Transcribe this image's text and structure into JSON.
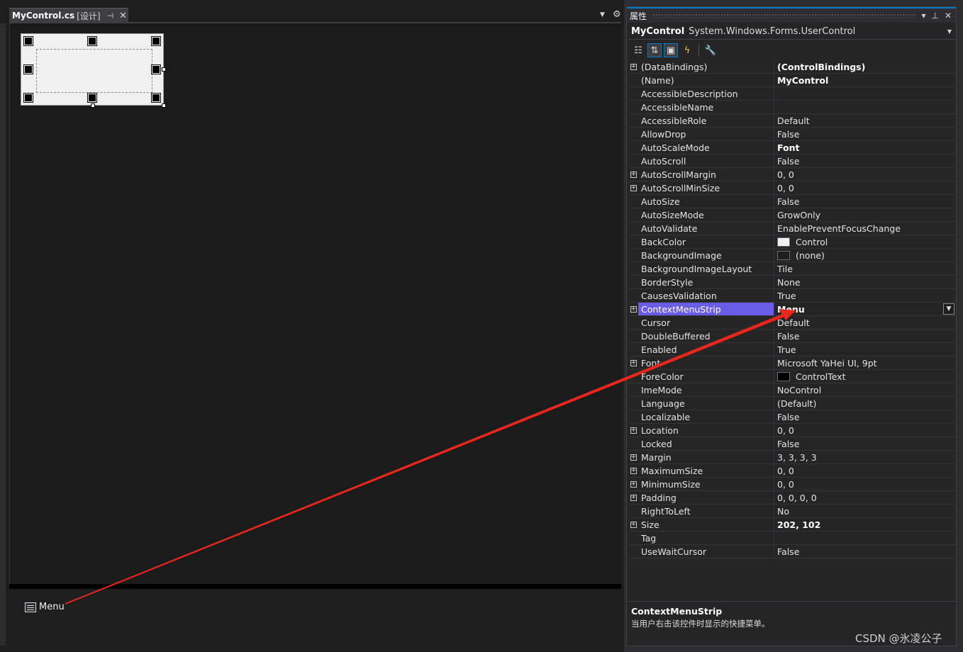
{
  "designer": {
    "tab_name": "MyControl.cs",
    "tab_mode": "[设计]",
    "tab_pin": "⊣",
    "tab_close": "✕",
    "overflow": "▼",
    "settings": "⚙",
    "tray_item_label": "Menu"
  },
  "properties": {
    "title": "属性",
    "title_buttons": [
      "▾",
      "⊥",
      "✕"
    ],
    "object_name": "MyControl",
    "object_type": "System.Windows.Forms.UserControl",
    "toolbar_icons": [
      "categorized-icon",
      "alphabetical-icon",
      "properties-icon",
      "events-icon",
      "property-pages-icon"
    ],
    "rows": [
      {
        "name": "(DataBindings)",
        "value": "(ControlBindings)",
        "expand": true,
        "bold": true
      },
      {
        "name": "(Name)",
        "value": "MyControl",
        "bold": true
      },
      {
        "name": "AccessibleDescription",
        "value": ""
      },
      {
        "name": "AccessibleName",
        "value": ""
      },
      {
        "name": "AccessibleRole",
        "value": "Default"
      },
      {
        "name": "AllowDrop",
        "value": "False"
      },
      {
        "name": "AutoScaleMode",
        "value": "Font",
        "bold": true
      },
      {
        "name": "AutoScroll",
        "value": "False"
      },
      {
        "name": "AutoScrollMargin",
        "value": "0, 0",
        "expand": true
      },
      {
        "name": "AutoScrollMinSize",
        "value": "0, 0",
        "expand": true
      },
      {
        "name": "AutoSize",
        "value": "False"
      },
      {
        "name": "AutoSizeMode",
        "value": "GrowOnly"
      },
      {
        "name": "AutoValidate",
        "value": "EnablePreventFocusChange"
      },
      {
        "name": "BackColor",
        "value": "Control",
        "swatch": "#f0f0f0"
      },
      {
        "name": "BackgroundImage",
        "value": "(none)",
        "swatch": "#1e1e1e"
      },
      {
        "name": "BackgroundImageLayout",
        "value": "Tile"
      },
      {
        "name": "BorderStyle",
        "value": "None"
      },
      {
        "name": "CausesValidation",
        "value": "True"
      },
      {
        "name": "ContextMenuStrip",
        "value": "Menu",
        "expand": true,
        "bold": true,
        "selected": true
      },
      {
        "name": "Cursor",
        "value": "Default"
      },
      {
        "name": "DoubleBuffered",
        "value": "False"
      },
      {
        "name": "Enabled",
        "value": "True"
      },
      {
        "name": "Font",
        "value": "Microsoft YaHei UI, 9pt",
        "expand": true
      },
      {
        "name": "ForeColor",
        "value": "ControlText",
        "swatch": "#000000"
      },
      {
        "name": "ImeMode",
        "value": "NoControl"
      },
      {
        "name": "Language",
        "value": "(Default)"
      },
      {
        "name": "Localizable",
        "value": "False"
      },
      {
        "name": "Location",
        "value": "0, 0",
        "expand": true
      },
      {
        "name": "Locked",
        "value": "False"
      },
      {
        "name": "Margin",
        "value": "3, 3, 3, 3",
        "expand": true
      },
      {
        "name": "MaximumSize",
        "value": "0, 0",
        "expand": true
      },
      {
        "name": "MinimumSize",
        "value": "0, 0",
        "expand": true
      },
      {
        "name": "Padding",
        "value": "0, 0, 0, 0",
        "expand": true
      },
      {
        "name": "RightToLeft",
        "value": "No"
      },
      {
        "name": "Size",
        "value": "202, 102",
        "expand": true,
        "bold": true
      },
      {
        "name": "Tag",
        "value": ""
      },
      {
        "name": "UseWaitCursor",
        "value": "False"
      }
    ],
    "description_title": "ContextMenuStrip",
    "description_text": "当用户右击该控件时显示的快捷菜单。"
  },
  "watermark": "CSDN @氷凌公子",
  "colors": {
    "selection": "#6b5ce7",
    "annotation_arrow": "#e8261c"
  }
}
